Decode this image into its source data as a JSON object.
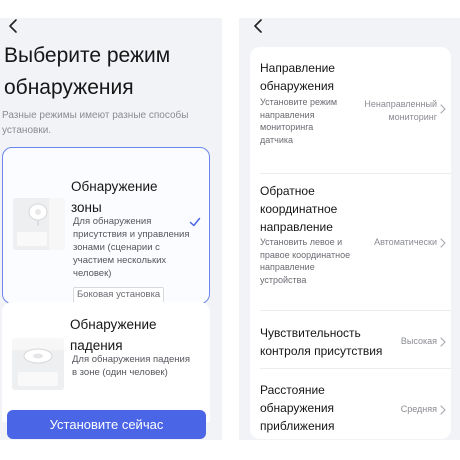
{
  "left_screen": {
    "title": "Выберите режим обнаружения",
    "subtitle": "Разные режимы имеют разные способы установки.",
    "cards": [
      {
        "title": "Обнаружение зоны",
        "description": "Для обнаружения присутствия и управления зонами (сценарии с участием нескольких человек)",
        "badge": "Боковая установка",
        "selected": true
      },
      {
        "title": "Обнаружение падения",
        "description": "Для обнаружения падения в зоне (один человек)",
        "selected": false
      }
    ],
    "install_button": "Установите сейчас"
  },
  "right_screen": {
    "settings": [
      {
        "title": "Направление обнаружения",
        "description": "Установите режим направления мониторинга датчика",
        "value": "Ненаправленный мониторинг"
      },
      {
        "title": "Обратное координатное направление",
        "description": "Установить левое и правое координатное направление устройства",
        "value": "Автоматически"
      },
      {
        "title": "Чувствительность контроля присутствия",
        "value": "Высокая"
      },
      {
        "title": "Расстояние обнаружения приближения",
        "value": "Средняя"
      }
    ]
  },
  "colors": {
    "accent": "#4a66e6",
    "selected_border": "#6b86e8",
    "background": "#f2f3f7"
  },
  "icons": [
    "back-icon",
    "check-icon",
    "chevron-right-icon"
  ]
}
